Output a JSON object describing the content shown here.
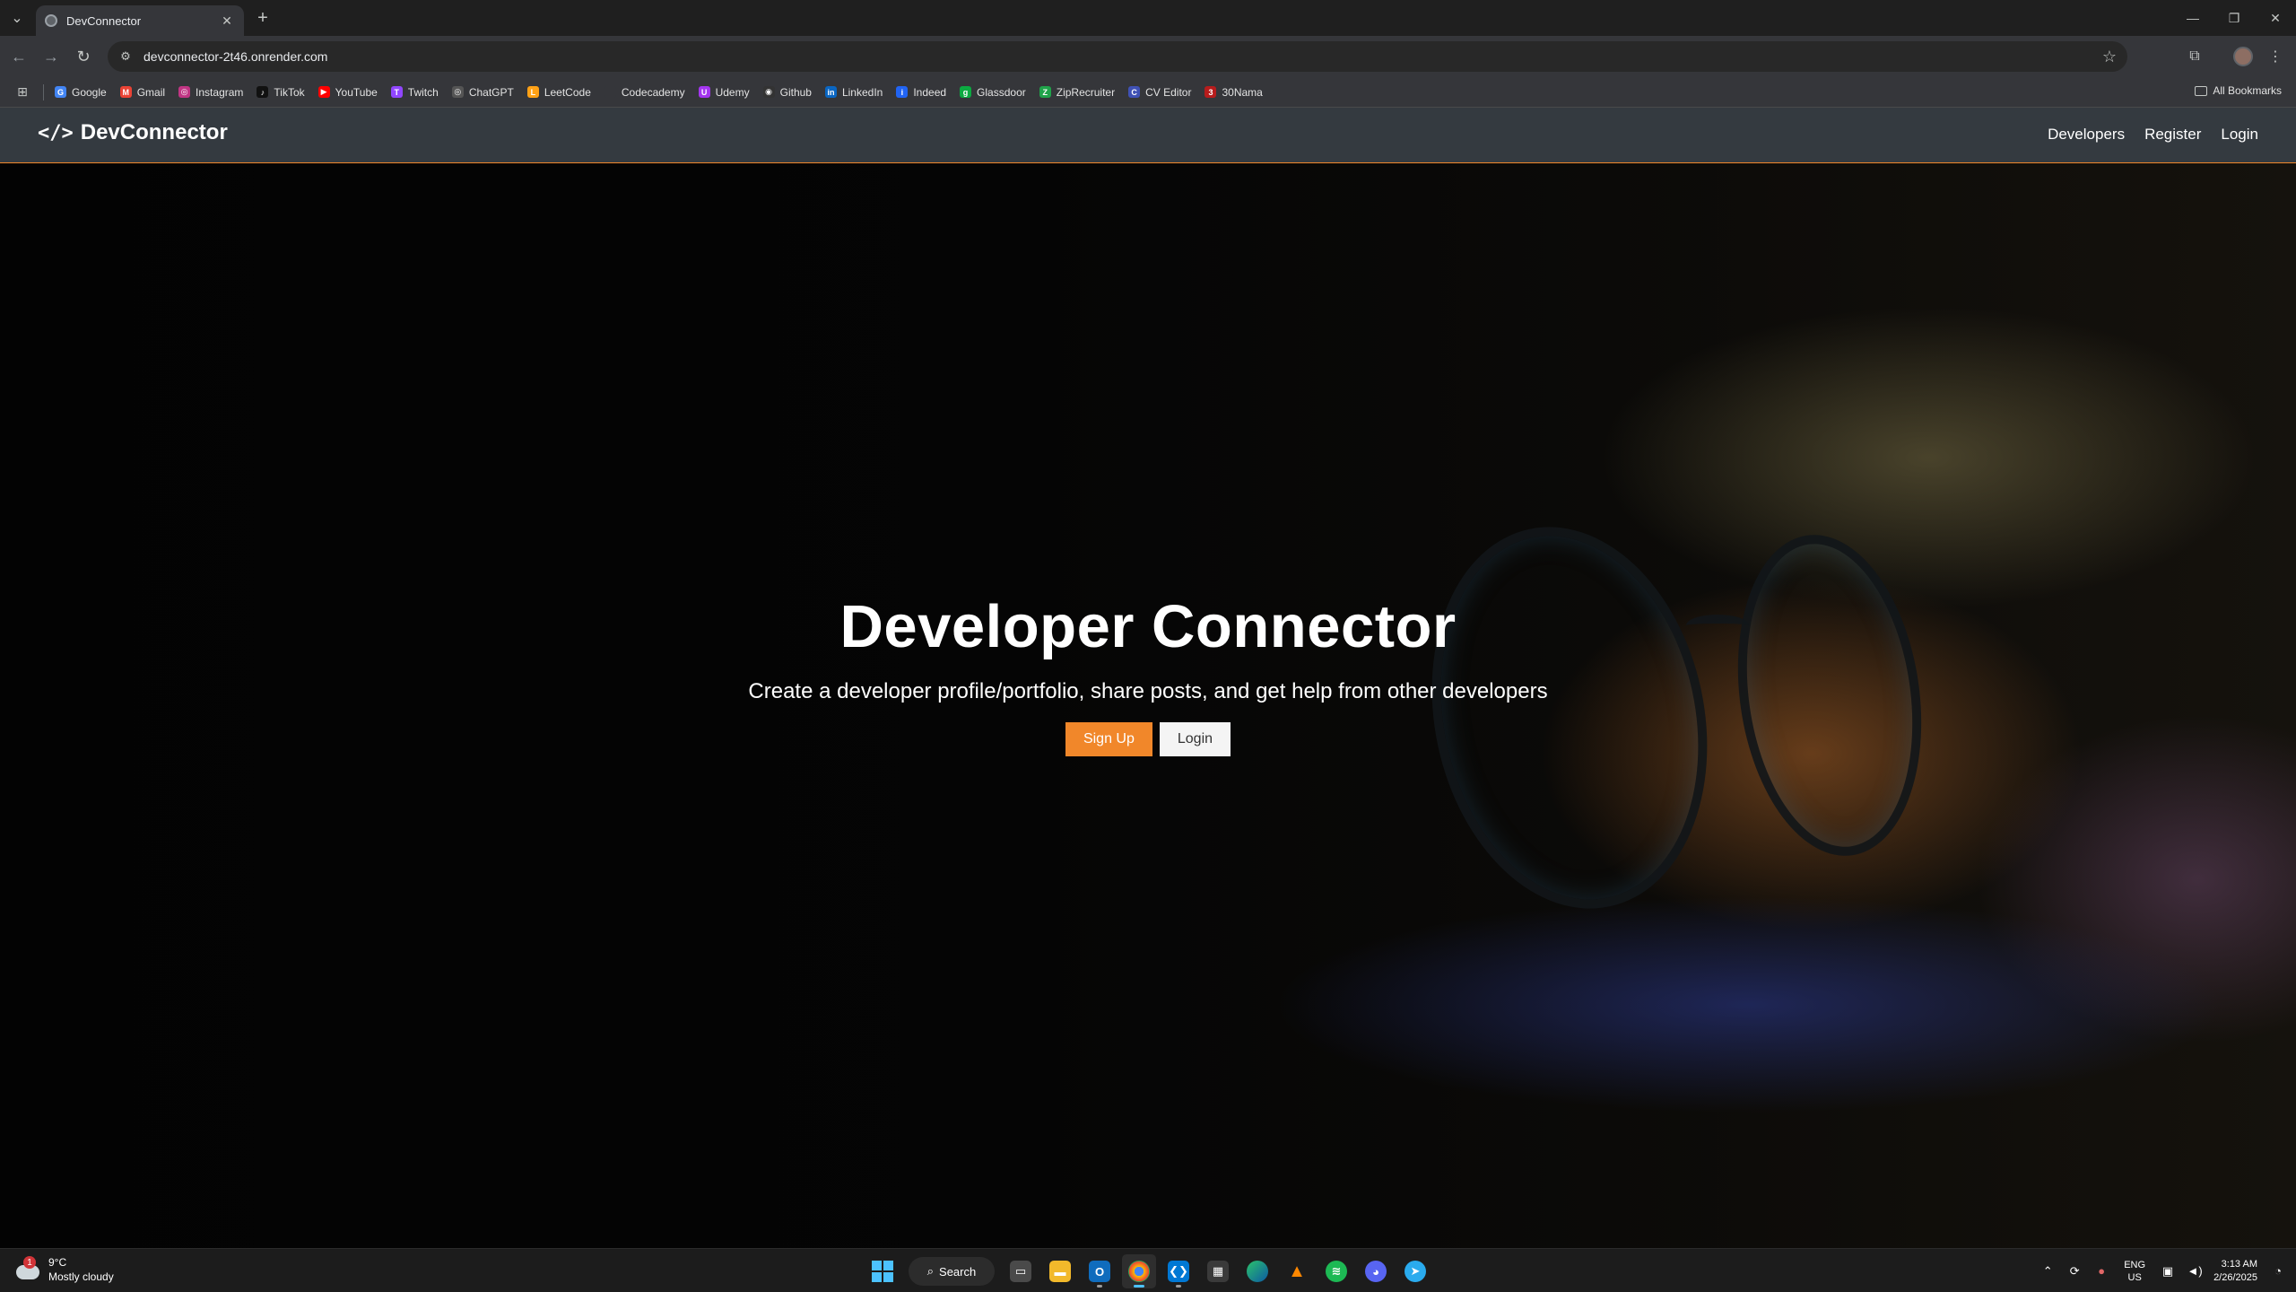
{
  "browser": {
    "tab_title": "DevConnector",
    "url": "devconnector-2t46.onrender.com",
    "bookmarks": [
      {
        "label": "Google",
        "color": "#4285f4",
        "glyph": "G"
      },
      {
        "label": "Gmail",
        "color": "#ea4335",
        "glyph": "M"
      },
      {
        "label": "Instagram",
        "color": "#c13584",
        "glyph": "◎"
      },
      {
        "label": "TikTok",
        "color": "#111111",
        "glyph": "♪"
      },
      {
        "label": "YouTube",
        "color": "#ff0000",
        "glyph": "▶"
      },
      {
        "label": "Twitch",
        "color": "#9146ff",
        "glyph": "T"
      },
      {
        "label": "ChatGPT",
        "color": "#555555",
        "glyph": "◎"
      },
      {
        "label": "LeetCode",
        "color": "#ffa116",
        "glyph": "L"
      },
      {
        "label": "Codecademy",
        "color": "#35363a",
        "glyph": ""
      },
      {
        "label": "Udemy",
        "color": "#a435f0",
        "glyph": "U"
      },
      {
        "label": "Github",
        "color": "#333333",
        "glyph": "◉"
      },
      {
        "label": "LinkedIn",
        "color": "#0a66c2",
        "glyph": "in"
      },
      {
        "label": "Indeed",
        "color": "#2164f3",
        "glyph": "i"
      },
      {
        "label": "Glassdoor",
        "color": "#0caa41",
        "glyph": "g"
      },
      {
        "label": "ZipRecruiter",
        "color": "#20a34a",
        "glyph": "Z"
      },
      {
        "label": "CV Editor",
        "color": "#3f51b5",
        "glyph": "C"
      },
      {
        "label": "30Nama",
        "color": "#b71c1c",
        "glyph": "3"
      }
    ],
    "all_bookmarks_label": "All Bookmarks"
  },
  "site": {
    "brand": "DevConnector",
    "brand_icon": "</>",
    "nav": {
      "developers": "Developers",
      "register": "Register",
      "login": "Login"
    },
    "accent_color": "#f1872a",
    "hero": {
      "title": "Developer Connector",
      "lead": "Create a developer profile/portfolio, share posts, and get help from other developers",
      "signup_label": "Sign Up",
      "login_label": "Login"
    }
  },
  "taskbar": {
    "weather_temp": "9°C",
    "weather_desc": "Mostly cloudy",
    "weather_badge": "1",
    "search_label": "Search",
    "lang_line1": "ENG",
    "lang_line2": "US",
    "time": "3:13 AM",
    "date": "2/26/2025"
  }
}
